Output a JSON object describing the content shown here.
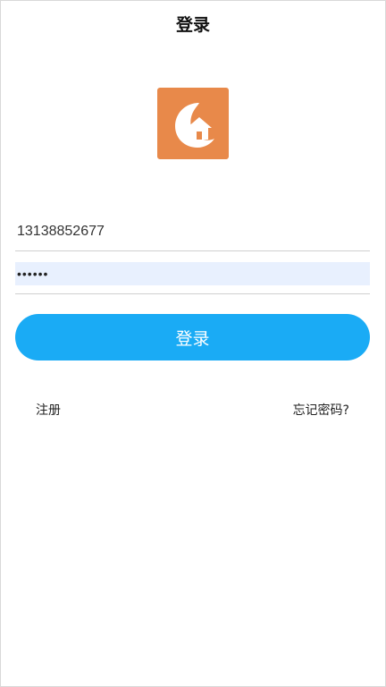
{
  "header": {
    "title": "登录"
  },
  "logo": {
    "icon": "house-moon-logo-icon",
    "bg_color": "#e8894a"
  },
  "form": {
    "phone_value": "13138852677",
    "password_value": "••••••",
    "login_label": "登录"
  },
  "links": {
    "register": "注册",
    "forgot": "忘记密码?"
  },
  "colors": {
    "primary": "#1aabf5",
    "autofill_bg": "#e8f0fe"
  }
}
